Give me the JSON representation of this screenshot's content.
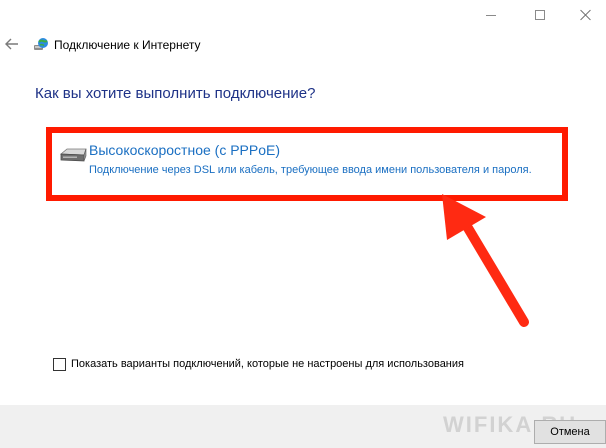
{
  "window": {
    "controls": [
      "minimize-icon",
      "maximize-icon",
      "close-icon"
    ]
  },
  "nav": {
    "back_icon": "arrow-left-icon",
    "app_icon": "network-globe-icon",
    "title": "Подключение к Интернету"
  },
  "main": {
    "question": "Как вы хотите выполнить подключение?",
    "options": [
      {
        "icon": "broadband-modem-icon",
        "title": "Высокоскоростное (с PPPoE)",
        "description": "Подключение через DSL или кабель, требующее ввода имени пользователя и пароля."
      }
    ],
    "highlight_color": "#ff1a00",
    "link_color": "#1a6fc2",
    "heading_color": "#1e3287"
  },
  "checkbox": {
    "label": "Показать варианты подключений, которые не настроены для использования",
    "checked": false
  },
  "footer": {
    "watermark": "WIFIKA.RU",
    "cancel_label": "Отмена"
  }
}
